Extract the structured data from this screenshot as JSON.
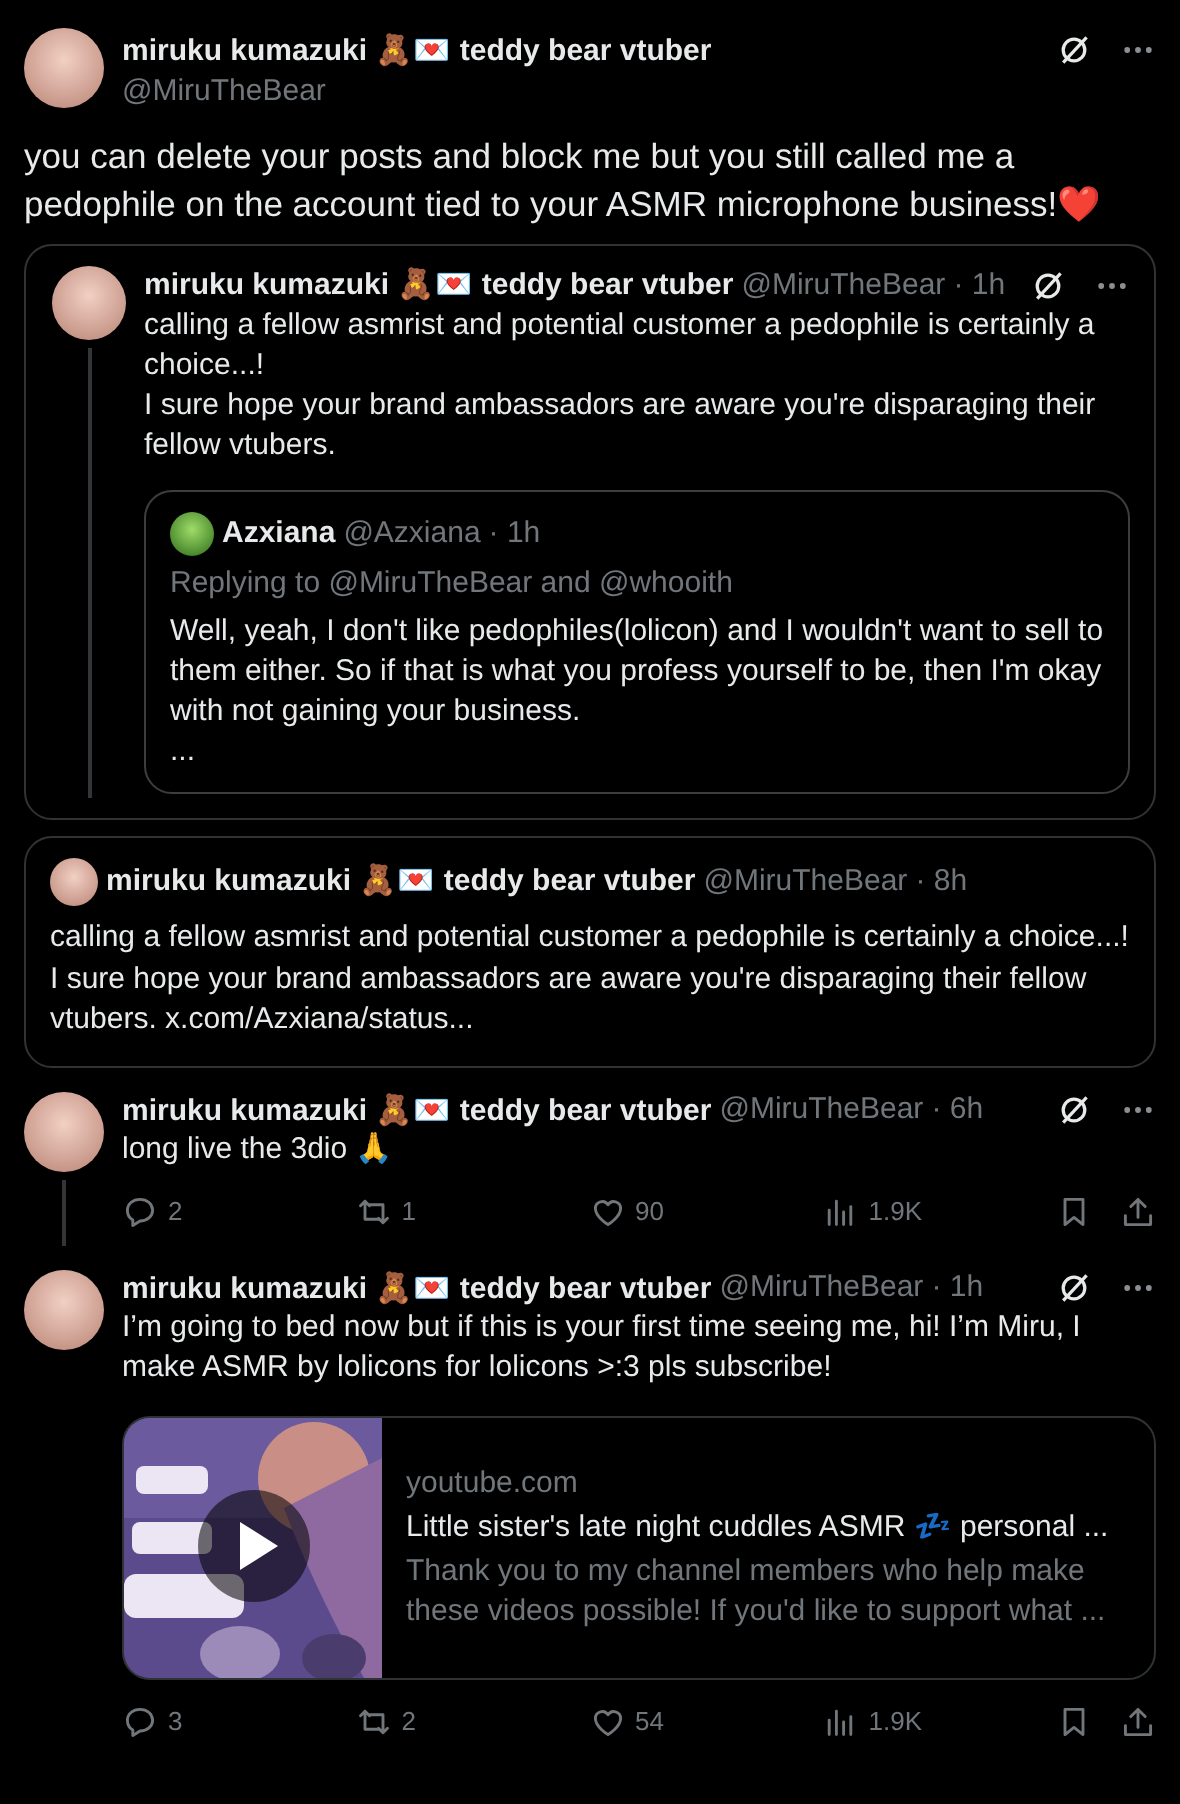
{
  "main_post": {
    "author": {
      "name": "miruku kumazuki 🧸💌 teddy bear vtuber",
      "handle": "@MiruTheBear"
    },
    "text": "you can delete your posts and block me but you still called me a pedophile on the account tied to your ASMR microphone business!❤️",
    "quote": {
      "author": {
        "name": "miruku kumazuki 🧸💌 teddy bear vtuber",
        "handle": "@MiruTheBear"
      },
      "time": "· 1h",
      "text": [
        "calling a fellow asmrist and potential customer a pedophile is certainly a choice...!",
        "I sure hope your brand ambassadors are aware you're disparaging their fellow vtubers."
      ],
      "quote": {
        "author": {
          "name": "Azxiana",
          "handle": "@Azxiana"
        },
        "time": "· 1h",
        "replying_to": "Replying to @MiruTheBear and @whooith",
        "text": [
          "Well, yeah, I don't like pedophiles(lolicon) and I wouldn't want to sell to them either.  So if that is what you profess yourself to be, then I'm okay with not gaining your business.",
          "..."
        ]
      }
    }
  },
  "quoted_post": {
    "author": {
      "name": "miruku kumazuki 🧸💌 teddy bear vtuber",
      "handle": "@MiruTheBear"
    },
    "time": "· 8h",
    "text": [
      "calling a fellow asmrist and potential customer a pedophile is certainly a choice...!",
      "I sure hope your brand ambassadors are aware you're disparaging their fellow vtubers. x.com/Azxiana/status..."
    ]
  },
  "replies": [
    {
      "author": {
        "name": "miruku kumazuki 🧸💌 teddy bear vtuber",
        "handle": "@MiruTheBear"
      },
      "time": "· 6h",
      "text": "long live the 3dio 🙏",
      "thread_continues": true,
      "actions": {
        "replies": "2",
        "reposts": "1",
        "likes": "90",
        "views": "1.9K"
      }
    },
    {
      "author": {
        "name": "miruku kumazuki 🧸💌 teddy bear vtuber",
        "handle": "@MiruTheBear"
      },
      "time": "· 1h",
      "text": "I’m going to bed now but if this is your first time seeing me, hi! I’m Miru, I make ASMR by lolicons for lolicons >:3 pls subscribe!",
      "thread_continues": false,
      "link_card": {
        "domain": "youtube.com",
        "title": "Little sister's late night cuddles ASMR 💤 personal ...",
        "description": "Thank you to my channel members who help make these videos possible! If you'd like to support what ..."
      },
      "actions": {
        "replies": "3",
        "reposts": "2",
        "likes": "54",
        "views": "1.9K"
      }
    }
  ]
}
